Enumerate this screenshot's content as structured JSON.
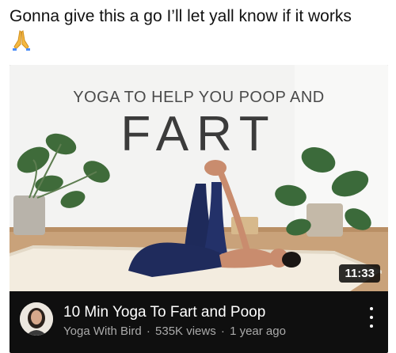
{
  "post": {
    "caption": "Gonna give this a go I’ll let yall know if it works",
    "emoji_icon": "folded-hands-icon"
  },
  "video": {
    "thumbnail": {
      "subtitle": "YOGA TO HELP YOU POOP AND",
      "headline": "FART"
    },
    "duration": "11:33",
    "title": "10 Min Yoga To Fart and Poop",
    "channel": "Yoga With Bird",
    "views": "535K views",
    "age": "1 year ago",
    "separator": "·",
    "menu_icon": "more-vertical-icon"
  },
  "colors": {
    "embed_background": "#0f0f0f",
    "title_text": "#ffffff",
    "secondary_text": "#aaaaaa"
  }
}
